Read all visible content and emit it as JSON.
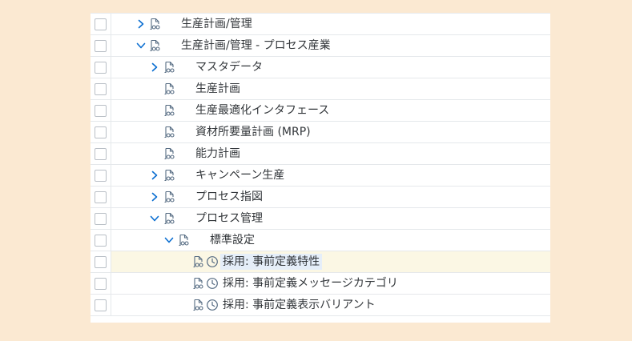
{
  "colors": {
    "background": "#fbe9d2",
    "panel": "#ffffff",
    "border": "#e5e8eb",
    "text": "#32363a",
    "accent": "#0a6ed1",
    "icon": "#556b82",
    "selected_row": "#fbf7e4"
  },
  "icons": {
    "expander_collapsed": "chevron-right-icon",
    "expander_expanded": "chevron-down-icon",
    "node": "document-glasses-icon",
    "activity": "clock-icon"
  },
  "tree": {
    "rows": [
      {
        "label": "生産計画/管理",
        "level": 0,
        "expander": "collapsed",
        "clock": false,
        "selected": false
      },
      {
        "label": "生産計画/管理 - プロセス産業",
        "level": 0,
        "expander": "expanded",
        "clock": false,
        "selected": false
      },
      {
        "label": "マスタデータ",
        "level": 1,
        "expander": "collapsed",
        "clock": false,
        "selected": false
      },
      {
        "label": "生産計画",
        "level": 1,
        "expander": "none",
        "clock": false,
        "selected": false
      },
      {
        "label": "生産最適化インタフェース",
        "level": 1,
        "expander": "none",
        "clock": false,
        "selected": false
      },
      {
        "label": "資材所要量計画 (MRP)",
        "level": 1,
        "expander": "none",
        "clock": false,
        "selected": false
      },
      {
        "label": "能力計画",
        "level": 1,
        "expander": "none",
        "clock": false,
        "selected": false
      },
      {
        "label": "キャンペーン生産",
        "level": 1,
        "expander": "collapsed",
        "clock": false,
        "selected": false
      },
      {
        "label": "プロセス指図",
        "level": 1,
        "expander": "collapsed",
        "clock": false,
        "selected": false
      },
      {
        "label": "プロセス管理",
        "level": 1,
        "expander": "expanded",
        "clock": false,
        "selected": false
      },
      {
        "label": "標準設定",
        "level": 2,
        "expander": "expanded",
        "clock": false,
        "selected": false
      },
      {
        "label": "採用: 事前定義特性",
        "level": 3,
        "expander": "none",
        "clock": true,
        "selected": true
      },
      {
        "label": "採用: 事前定義メッセージカテゴリ",
        "level": 3,
        "expander": "none",
        "clock": true,
        "selected": false
      },
      {
        "label": "採用: 事前定義表示バリアント",
        "level": 3,
        "expander": "none",
        "clock": true,
        "selected": false
      }
    ]
  }
}
